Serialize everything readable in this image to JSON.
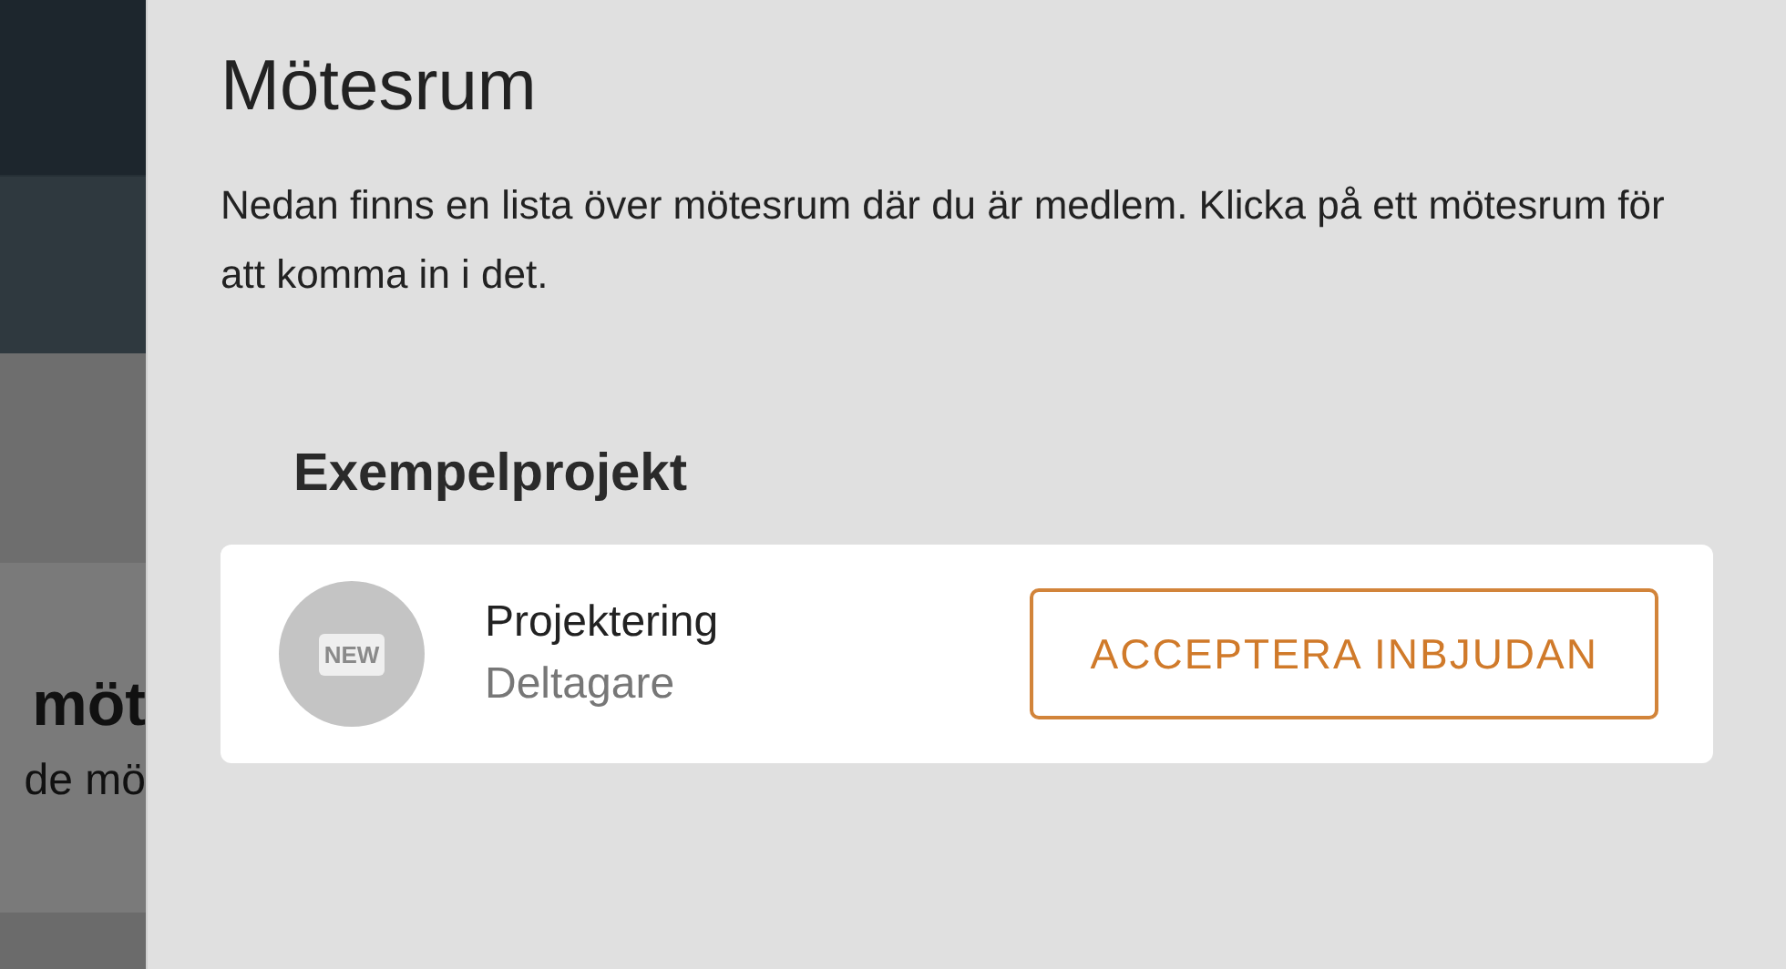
{
  "background": {
    "heading": "möt",
    "text": "de mö"
  },
  "drawer": {
    "title": "Mötesrum",
    "description": "Nedan finns en lista över mötesrum där du är medlem. Klicka på ett mötesrum för att komma in i det.",
    "groups": [
      {
        "title": "Exempelprojekt",
        "rooms": [
          {
            "badge": "NEW",
            "name": "Projektering",
            "role": "Deltagare",
            "action": "ACCEPTERA INBJUDAN"
          }
        ]
      }
    ]
  }
}
